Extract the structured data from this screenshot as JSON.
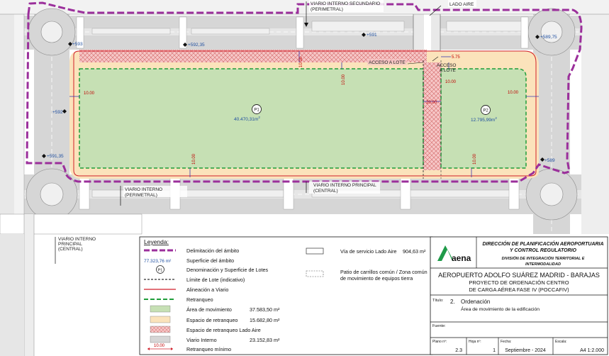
{
  "map": {
    "road_labels": {
      "secundario": "VIARIO INTERNO SECUNDARIO",
      "secundario_sub": "(PERIMETRAL)",
      "lado_aire": "LADO AIRE",
      "principal": "VIARIO INTERNO PRINCIPAL",
      "principal_sub": "(CENTRAL)",
      "perimetral_right": "VIARIO INTERNO",
      "perimetral_right_sub": "(PERIMETRAL)",
      "principal_left_1": "VIARIO INTERNO",
      "principal_left_2": "PRINCIPAL",
      "principal_left_3": "(CENTRAL)"
    },
    "access_labels": {
      "acceso_lote": "ACCESO A LOTE",
      "acceso_a": "ACCESO",
      "acceso_b": "A LOTE"
    },
    "elevations": [
      "+593",
      "+592,35",
      "+591",
      "+589,75",
      "+592",
      "+591,35",
      "+589"
    ],
    "dims": {
      "left": "10.00",
      "top_a": "10.00",
      "top_b": "10.00",
      "mid": "10.00",
      "right": "10.00",
      "bottom_a": "10.00",
      "bottom_b": "10.00",
      "strip": "20.00",
      "corner": "5.75"
    },
    "lots": [
      {
        "id": "P1",
        "area": "40.470,31m",
        "sup": "2"
      },
      {
        "id": "P2",
        "area": "12.795,99m",
        "sup": "2"
      }
    ]
  },
  "legend": {
    "title": "Leyenda:",
    "items_left": [
      {
        "label": "Delimitación del ámbito",
        "value": ""
      },
      {
        "label": "Superficie del ámbito",
        "value": ""
      },
      {
        "label": "Denominación y Superficie de Lotes",
        "value": ""
      },
      {
        "label": "Límite de Lote (indicativo)",
        "value": ""
      },
      {
        "label": "Alineación a Viario",
        "value": ""
      },
      {
        "label": "Retranqueo",
        "value": ""
      },
      {
        "label": "Área de movimiento",
        "value": "37.583,50 m²"
      },
      {
        "label": "Espacio de retranqueo",
        "value": "15.682,80 m²"
      },
      {
        "label": "Espacio de retranqueo Lado Aire",
        "value": ""
      },
      {
        "label": "Viario Interno",
        "value": "23.152,83 m²"
      },
      {
        "label": "Retranqueo mínimo",
        "value": ""
      }
    ],
    "surface_value": "77.323,76 m²",
    "lot_symbol": "P1",
    "min_dim_sample": "10.00",
    "items_right": [
      {
        "label": "Vía de servicio Lado Aire",
        "value": "904,63 m²"
      },
      {
        "label": "Patio de carrillos común / Zona común",
        "label2": "de movimiento de equipos tierra"
      }
    ]
  },
  "title_block": {
    "logo_text": "aena",
    "direccion_1": "DIRECCIÓN DE PLANIFICACIÓN AEROPORTUARIA",
    "direccion_2": "Y CONTROL REGULATORIO",
    "division_1": "DIVISIÓN DE INTEGRACIÓN TERRITORIAL E",
    "division_2": "INTERMODALIDAD",
    "airport": "AEROPUERTO ADOLFO SUÁREZ MADRID - BARAJAS",
    "project_1": "PROYECTO DE ORDENACIÓN CENTRO",
    "project_2": "DE CARGA AÉREA FASE IV (POCCAFIV)",
    "titulo_label": "Título:",
    "titulo_num": "2.",
    "titulo_main": "Ordenación",
    "titulo_sub": "Área de movimiento de la edificación",
    "fuente_label": "Fuente:",
    "plano_label": "Plano nº:",
    "plano_value": "2.3",
    "hoja_label": "Hoja nº:",
    "hoja_value": "1",
    "fecha_label": "Fecha:",
    "fecha_value": "Septiembre - 2024",
    "escala_label": "Escala:",
    "escala_value": "A4  1:2.000"
  },
  "colors": {
    "green_area": "#c6e0b4",
    "beige_setback": "#fbe3bb",
    "red_hatch": "#f4b6b6",
    "purple_boundary": "#9b2f9b",
    "red_alignment": "#d01f2a",
    "green_dash": "#1f9e3a",
    "road_gray": "#d4d4d4",
    "aena_green": "#1e9a48"
  }
}
